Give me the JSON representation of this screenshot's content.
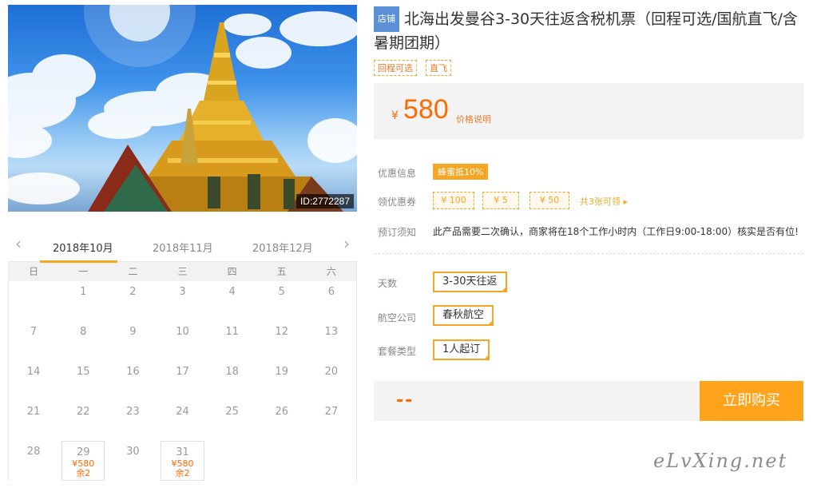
{
  "photo": {
    "id_label": "ID:2772287"
  },
  "calendar": {
    "months": [
      "2018年10月",
      "2018年11月",
      "2018年12月"
    ],
    "weekdays": [
      "日",
      "一",
      "二",
      "三",
      "四",
      "五",
      "六"
    ],
    "days": [
      {
        "n": ""
      },
      {
        "n": "1"
      },
      {
        "n": "2"
      },
      {
        "n": "3"
      },
      {
        "n": "4"
      },
      {
        "n": "5"
      },
      {
        "n": "6"
      },
      {
        "n": "7"
      },
      {
        "n": "8"
      },
      {
        "n": "9"
      },
      {
        "n": "10"
      },
      {
        "n": "11"
      },
      {
        "n": "12"
      },
      {
        "n": "13"
      },
      {
        "n": "14"
      },
      {
        "n": "15"
      },
      {
        "n": "16"
      },
      {
        "n": "17"
      },
      {
        "n": "18"
      },
      {
        "n": "19"
      },
      {
        "n": "20"
      },
      {
        "n": "21"
      },
      {
        "n": "22"
      },
      {
        "n": "23"
      },
      {
        "n": "24"
      },
      {
        "n": "25"
      },
      {
        "n": "26"
      },
      {
        "n": "27"
      },
      {
        "n": "28"
      },
      {
        "n": "29",
        "price": "¥580",
        "left": "余2"
      },
      {
        "n": "30"
      },
      {
        "n": "31",
        "price": "¥580",
        "left": "余2"
      },
      {
        "n": ""
      },
      {
        "n": ""
      },
      {
        "n": ""
      }
    ]
  },
  "product": {
    "shop_tag": "店铺",
    "title": "北海出发曼谷3-30天往返含税机票（回程可选/国航直飞/含暑期团期）",
    "tags": [
      "回程可选",
      "直飞"
    ],
    "price_symbol": "¥",
    "price": "580",
    "price_note": "价格说明"
  },
  "info": {
    "discount_label": "优惠信息",
    "discount_badge": "蜂蜜抵10%",
    "coupon_label": "领优惠券",
    "coupons": [
      "¥ 100",
      "¥ 5",
      "¥ 50"
    ],
    "coupon_more": "共3张可领 ▸",
    "notice_label": "预订须知",
    "notice_text": "此产品需要二次确认，商家将在18个工作小时内（工作日9:00-18:00）核实是否有位!"
  },
  "options": {
    "days_label": "天数",
    "days_value": "3-30天往返",
    "airline_label": "航空公司",
    "airline_value": "春秋航空",
    "package_label": "套餐类型",
    "package_value": "1人起订"
  },
  "buy": {
    "total_placeholder": "--",
    "button": "立即购买"
  },
  "watermark": "eLvXing.net",
  "colors": {
    "accent": "#f5a623",
    "price": "#ff6a00",
    "shop_tag": "#5b8fd8"
  }
}
